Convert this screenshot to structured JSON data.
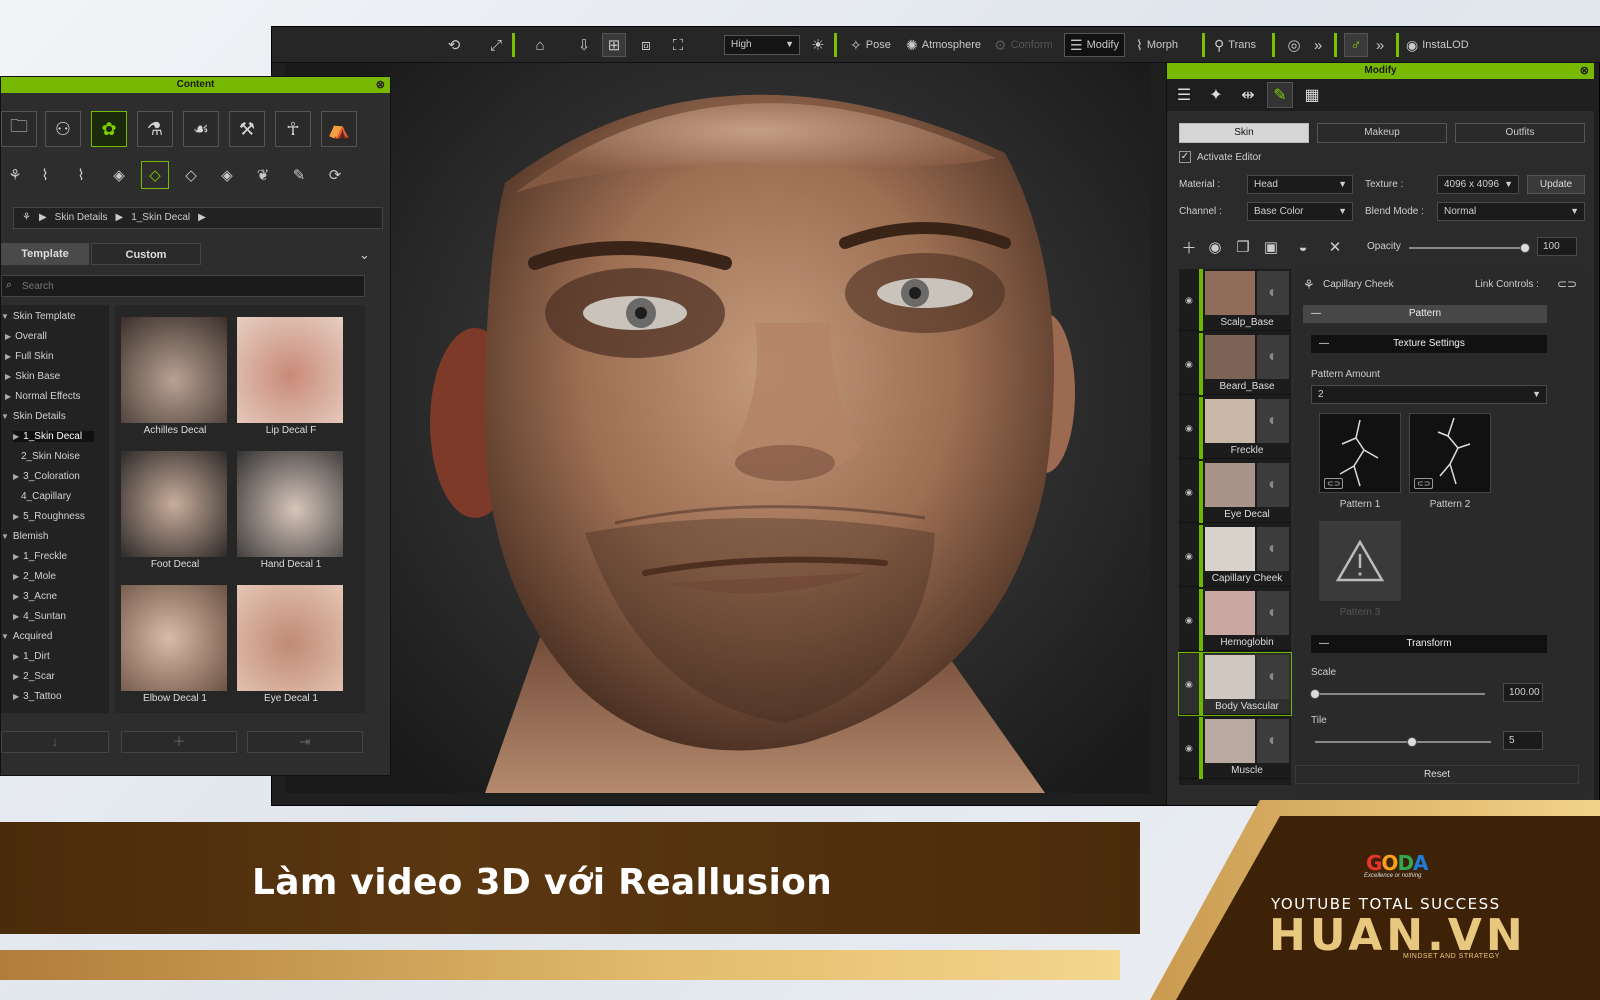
{
  "toolbar": {
    "quality_select": "High",
    "pose_label": "Pose",
    "atmosphere_label": "Atmosphere",
    "conform_label": "Conform",
    "modify_label": "Modify",
    "morph_label": "Morph",
    "trans_label": "Trans",
    "instalod_label": "InstaLOD"
  },
  "modify_panel": {
    "title": "Modify",
    "tabs": [
      "Skin",
      "Makeup",
      "Outfits"
    ],
    "activate_editor_label": "Activate Editor",
    "material_label": "Material :",
    "material_value": "Head",
    "texture_label": "Texture :",
    "texture_value": "4096 x 4096",
    "update_label": "Update",
    "channel_label": "Channel :",
    "channel_value": "Base Color",
    "blend_label": "Blend Mode :",
    "blend_value": "Normal",
    "opacity_label": "Opacity",
    "opacity_value": "100",
    "opacity_fraction": 1.0,
    "layers": [
      {
        "name": "Scalp_Base"
      },
      {
        "name": "Beard_Base"
      },
      {
        "name": "Freckle"
      },
      {
        "name": "Eye Decal"
      },
      {
        "name": "Capillary Cheek"
      },
      {
        "name": "Hemoglobin"
      },
      {
        "name": "Body Vascular"
      },
      {
        "name": "Muscle"
      }
    ],
    "props": {
      "layer_name": "Capillary Cheek",
      "link_controls_label": "Link Controls :",
      "pattern_section": "Pattern",
      "texture_settings_section": "Texture Settings",
      "pattern_amount_label": "Pattern Amount",
      "pattern_amount_value": "2",
      "pattern_1_label": "Pattern 1",
      "pattern_2_label": "Pattern 2",
      "pattern_3_label": "Pattern 3",
      "transform_section": "Transform",
      "scale_label": "Scale",
      "scale_value": "100.00",
      "scale_fraction": 0.0,
      "tile_label": "Tile",
      "tile_value": "5",
      "tile_fraction": 0.55,
      "reset_label": "Reset"
    }
  },
  "content_panel": {
    "title": "Content",
    "breadcrumb": [
      "Skin Details",
      "1_Skin Decal"
    ],
    "tabs": [
      "Template",
      "Custom"
    ],
    "search_placeholder": "Search",
    "tree": [
      {
        "label": "Skin Template",
        "toggle": "▼"
      },
      {
        "label": "Overall",
        "toggle": "▶"
      },
      {
        "label": "Full Skin",
        "toggle": "▶"
      },
      {
        "label": "Skin Base",
        "toggle": "▶"
      },
      {
        "label": "Normal Effects",
        "toggle": "▶"
      },
      {
        "label": "Skin Details",
        "toggle": "▼"
      },
      {
        "label": "1_Skin Decal",
        "toggle": "▶"
      },
      {
        "label": "2_Skin Noise",
        "toggle": ""
      },
      {
        "label": "3_Coloration",
        "toggle": "▶"
      },
      {
        "label": "4_Capillary",
        "toggle": ""
      },
      {
        "label": "5_Roughness",
        "toggle": "▶"
      },
      {
        "label": "Blemish",
        "toggle": "▼"
      },
      {
        "label": "1_Freckle",
        "toggle": "▶"
      },
      {
        "label": "2_Mole",
        "toggle": "▶"
      },
      {
        "label": "3_Acne",
        "toggle": "▶"
      },
      {
        "label": "4_Suntan",
        "toggle": "▶"
      },
      {
        "label": "Acquired",
        "toggle": "▼"
      },
      {
        "label": "1_Dirt",
        "toggle": "▶"
      },
      {
        "label": "2_Scar",
        "toggle": "▶"
      },
      {
        "label": "3_Tattoo",
        "toggle": "▶"
      }
    ],
    "grid": [
      {
        "label": "Achilles Decal"
      },
      {
        "label": "Lip Decal F"
      },
      {
        "label": "Foot Decal"
      },
      {
        "label": "Hand Decal 1"
      },
      {
        "label": "Elbow Decal 1"
      },
      {
        "label": "Eye Decal 1"
      }
    ]
  },
  "banner": {
    "title": "Làm video 3D với Reallusion",
    "goda_letters": [
      "G",
      "O",
      "D",
      "A"
    ],
    "goda_colors": [
      "#e8342a",
      "#f6a21b",
      "#2fa84f",
      "#1f7bd8"
    ],
    "goda_tagline": "Excellence or nothing",
    "channel_line": "YOUTUBE TOTAL SUCCESS",
    "brand": "HUAN.VN",
    "brand_sub": "MINDSET AND STRATEGY"
  }
}
